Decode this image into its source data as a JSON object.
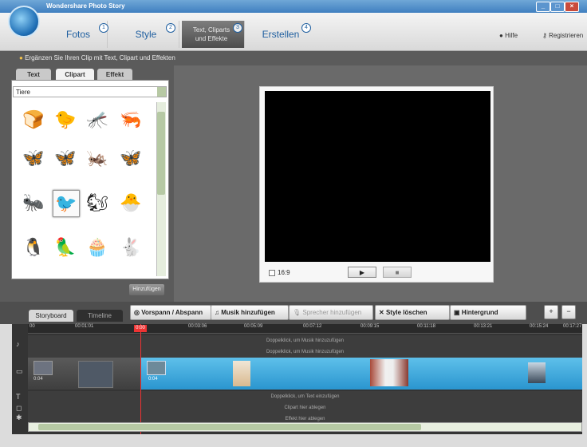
{
  "window": {
    "title": "Wondershare Photo Story",
    "buttons": [
      "_",
      "□",
      "×"
    ]
  },
  "nav": {
    "tabs": [
      {
        "label": "Fotos",
        "step": "1"
      },
      {
        "label": "Style",
        "step": "2"
      },
      {
        "label": "Text, Cliparts und Effekte",
        "step": "3"
      },
      {
        "label": "Erstellen",
        "step": "4"
      }
    ],
    "help_label": "Hilfe",
    "register_label": "Registrieren"
  },
  "hint": {
    "text": "Ergänzen Sie Ihren Clip mit Text, Clipart und Effekten"
  },
  "left_panel": {
    "tabs": [
      "Text",
      "Clipart",
      "Effekt"
    ],
    "category_select": "Tiere",
    "add_button": "Hinzufügen",
    "cliparts": [
      {
        "name": "bread-clipart",
        "glyph": "🍞"
      },
      {
        "name": "chick-clipart",
        "glyph": "🐤"
      },
      {
        "name": "dragonfly-clipart",
        "glyph": "🦟"
      },
      {
        "name": "seahorse-clipart",
        "glyph": "🦐"
      },
      {
        "name": "butterfly-dark-clipart",
        "glyph": "🦋"
      },
      {
        "name": "butterfly-blue-clipart",
        "glyph": "🦋"
      },
      {
        "name": "dragonfly-yellow-clipart",
        "glyph": "🦗"
      },
      {
        "name": "butterfly-navy-clipart",
        "glyph": "🦋"
      },
      {
        "name": "ant-clipart",
        "glyph": "🐜"
      },
      {
        "name": "bird-clipart",
        "glyph": "🐦"
      },
      {
        "name": "squirrel-clipart",
        "glyph": "🐿"
      },
      {
        "name": "chick-nest-clipart",
        "glyph": "🐣"
      },
      {
        "name": "penguin-clipart",
        "glyph": "🐧"
      },
      {
        "name": "bird-colorful-clipart",
        "glyph": "🦜"
      },
      {
        "name": "cupcake-clipart",
        "glyph": "🧁"
      },
      {
        "name": "rabbit-clipart",
        "glyph": "🐇"
      }
    ]
  },
  "preview": {
    "ratio_label": "16:9",
    "play_glyph": "▶",
    "stop_glyph": "■"
  },
  "toolbar": {
    "view_tabs": [
      "Storyboard",
      "Timeline"
    ],
    "buttons": {
      "voiceover": "Vorspann / Abspann",
      "music": "Musik hinzufügen",
      "narration": "Sprecher hinzufügen",
      "delete_style": "Style löschen",
      "background": "Hintergrund"
    },
    "zoom_in": "+",
    "zoom_out": "−"
  },
  "timeline": {
    "ruler": [
      "00",
      "00:01:01",
      "00:03:06",
      "00:05:09",
      "00:07:12",
      "00:09:15",
      "00:11:18",
      "00:13:21",
      "00:15:24",
      "00:17:27"
    ],
    "playhead_label": "0:00",
    "music_tracks": [
      "Doppelklick, um Musik hinzuzufügen",
      "Doppelklick, um Musik hinzuzufügen"
    ],
    "text_tracks": [
      "Doppelklick, um Text einzufügen",
      "Clipart hier ablegen",
      "Effekt hier ablegen"
    ],
    "thumb_labels": [
      "0:04",
      "0:04"
    ]
  }
}
